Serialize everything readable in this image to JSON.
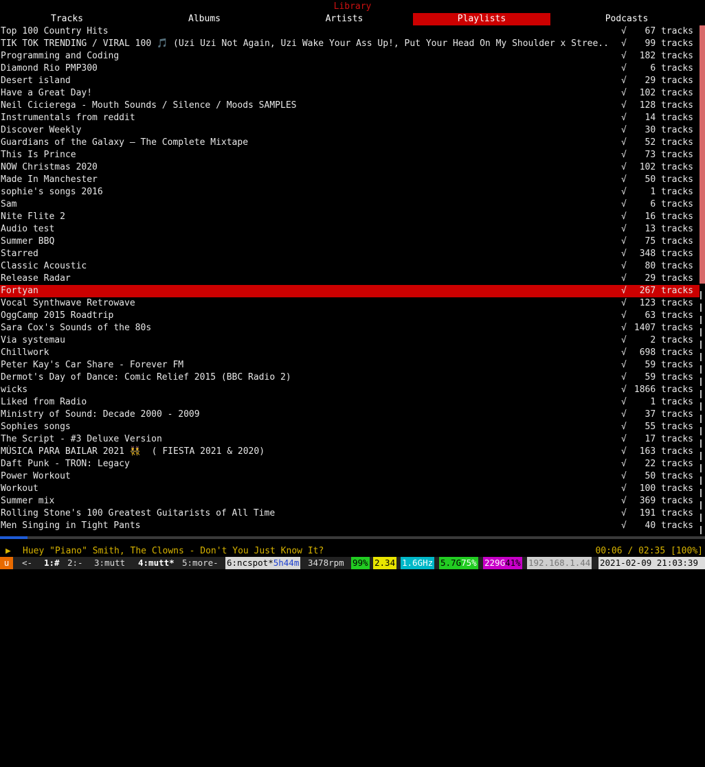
{
  "header": {
    "title": "Library"
  },
  "tabs": [
    {
      "label": "Tracks",
      "active": false
    },
    {
      "label": "Albums",
      "active": false
    },
    {
      "label": "Artists",
      "active": false
    },
    {
      "label": "Playlists",
      "active": true
    },
    {
      "label": "Podcasts",
      "active": false
    }
  ],
  "check_mark": "√",
  "playlists": [
    {
      "name": "Top 100 Country Hits",
      "count": "67 tracks"
    },
    {
      "name": "TIK TOK TRENDING / VIRAL 100 🎵 (Uzi Uzi Not Again, Uzi Wake Your Ass Up!, Put Your Head On My Shoulder x Stree..",
      "count": "99 tracks"
    },
    {
      "name": "Programming and Coding",
      "count": "182 tracks"
    },
    {
      "name": "Diamond Rio PMP300",
      "count": "6 tracks"
    },
    {
      "name": "Desert island",
      "count": "29 tracks"
    },
    {
      "name": "Have a Great Day!",
      "count": "102 tracks"
    },
    {
      "name": "Neil Cicierega - Mouth Sounds / Silence / Moods SAMPLES",
      "count": "128 tracks"
    },
    {
      "name": "Instrumentals from reddit",
      "count": "14 tracks"
    },
    {
      "name": "Discover Weekly",
      "count": "30 tracks"
    },
    {
      "name": "Guardians of the Galaxy – The Complete Mixtape",
      "count": "52 tracks"
    },
    {
      "name": "This Is Prince",
      "count": "73 tracks"
    },
    {
      "name": "NOW Christmas 2020",
      "count": "102 tracks"
    },
    {
      "name": "Made In Manchester",
      "count": "50 tracks"
    },
    {
      "name": "sophie's songs 2016",
      "count": "1 tracks"
    },
    {
      "name": "Sam",
      "count": "6 tracks"
    },
    {
      "name": "Nite Flite 2",
      "count": "16 tracks"
    },
    {
      "name": "Audio test",
      "count": "13 tracks"
    },
    {
      "name": "Summer BBQ",
      "count": "75 tracks"
    },
    {
      "name": "Starred",
      "count": "348 tracks"
    },
    {
      "name": "Classic Acoustic",
      "count": "80 tracks"
    },
    {
      "name": "Release Radar",
      "count": "29 tracks"
    },
    {
      "name": "Fortyan",
      "count": "267 tracks",
      "selected": true
    },
    {
      "name": "Vocal Synthwave Retrowave",
      "count": "123 tracks"
    },
    {
      "name": "OggCamp 2015 Roadtrip",
      "count": "63 tracks"
    },
    {
      "name": "Sara Cox's Sounds of the 80s",
      "count": "1407 tracks"
    },
    {
      "name": "Via systemau",
      "count": "2 tracks"
    },
    {
      "name": "Chillwork",
      "count": "698 tracks"
    },
    {
      "name": "Peter Kay's Car Share - Forever FM",
      "count": "59 tracks"
    },
    {
      "name": "Dermot's Day of Dance: Comic Relief 2015 (BBC Radio 2)",
      "count": "59 tracks"
    },
    {
      "name": "wicks",
      "count": "1866 tracks"
    },
    {
      "name": "Liked from Radio",
      "count": "1 tracks"
    },
    {
      "name": "Ministry of Sound: Decade 2000 - 2009",
      "count": "37 tracks"
    },
    {
      "name": "Sophies songs",
      "count": "55 tracks"
    },
    {
      "name": "The Script - #3 Deluxe Version",
      "count": "17 tracks"
    },
    {
      "name": "MÚSICA PARA BAILAR 2021 👯  ( FIESTA 2021 & 2020)",
      "count": "163 tracks"
    },
    {
      "name": "Daft Punk - TRON: Legacy",
      "count": "22 tracks"
    },
    {
      "name": "Power Workout",
      "count": "50 tracks"
    },
    {
      "name": "Workout",
      "count": "100 tracks"
    },
    {
      "name": "Summer mix",
      "count": "369 tracks"
    },
    {
      "name": "Rolling Stone's 100 Greatest Guitarists of All Time",
      "count": "191 tracks"
    },
    {
      "name": "Men Singing in Tight Pants",
      "count": "40 tracks"
    }
  ],
  "scrollbar": {
    "position_fraction": 0.0,
    "visible_fraction": 0.51
  },
  "player": {
    "icon": "play-icon",
    "glyph": "▶",
    "track": "Huey \"Piano\" Smith, The Clowns - Don't You Just Know It?",
    "time": "00:06 / 02:35 [100%]",
    "progress_fraction": 0.039
  },
  "statusbar": {
    "session": "u",
    "back": "<-",
    "windows": [
      {
        "label": "1:#",
        "bold": true
      },
      {
        "label": "2:-",
        "bold": false
      },
      {
        "label": "3:mutt",
        "bold": false
      },
      {
        "label": "4:mutt*",
        "bold": true
      },
      {
        "label": "5:more-",
        "bold": false
      }
    ],
    "ncspot_label": "6:ncspot*",
    "ncspot_time": "5h44m",
    "rpm": "3478rpm",
    "battery": "99%",
    "load": "2.34",
    "cpu_freq": "1.6GHz",
    "mem_used": "5.7G",
    "mem_pct": "75%",
    "disk_free": "229G",
    "disk_pct": "41%",
    "ip": "192.168.1.44",
    "datetime": "2021-02-09 21:03:39"
  },
  "colors": {
    "accent": "#cc0000",
    "title": "#cc1111",
    "player": "#d8b400",
    "progress": "#1e5bd6"
  }
}
